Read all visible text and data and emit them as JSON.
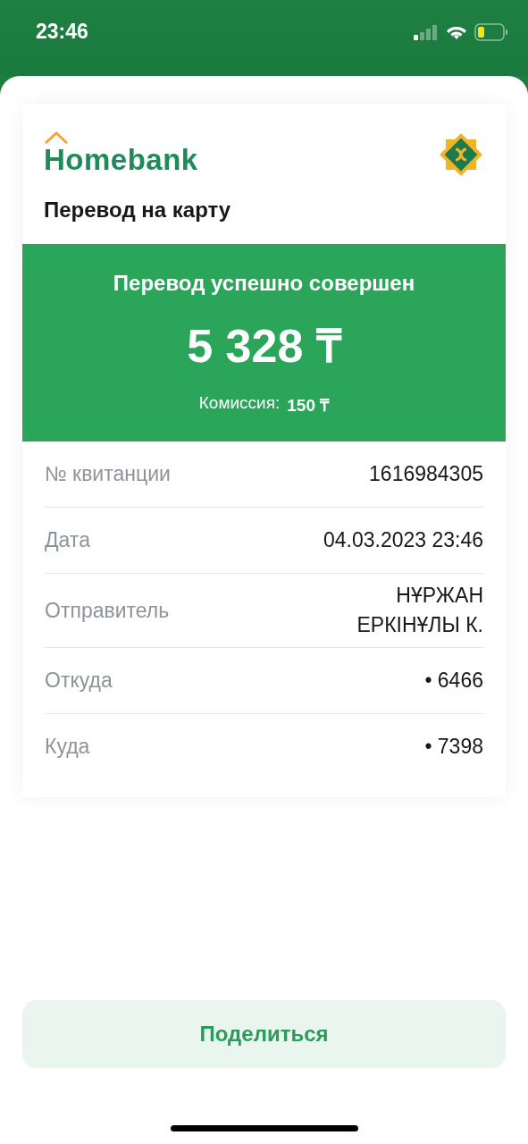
{
  "status_bar": {
    "time": "23:46"
  },
  "receipt": {
    "brand": "Homebank",
    "title": "Перевод на карту",
    "banner": {
      "message": "Перевод успешно совершен",
      "amount": "5 328 ₸",
      "fee_label": "Комиссия:",
      "fee": "150 ₸"
    },
    "rows": [
      {
        "label": "№ квитанции",
        "value": "1616984305"
      },
      {
        "label": "Дата",
        "value": "04.03.2023 23:46"
      },
      {
        "label": "Отправитель",
        "value": "НҰРЖАН ЕРКІНҰЛЫ К."
      },
      {
        "label": "Откуда",
        "value": "• 6466"
      },
      {
        "label": "Куда",
        "value": "• 7398"
      }
    ]
  },
  "share_button": {
    "label": "Поделиться"
  }
}
